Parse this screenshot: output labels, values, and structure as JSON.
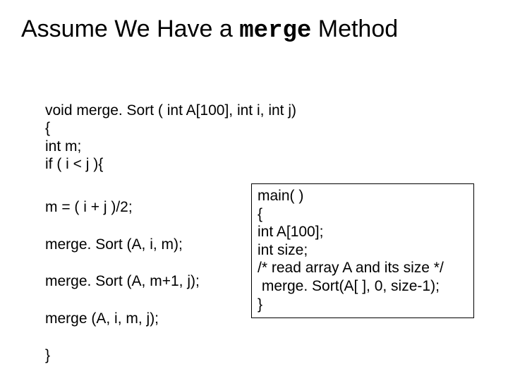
{
  "title_pre": "Assume We Have a ",
  "title_mono": "merge",
  "title_post": " Method",
  "left": {
    "l1": "void merge. Sort ( int A[100], int i, int j)",
    "l2": "{",
    "l3": "int m;",
    "l4": "if ( i < j ){",
    "b1": "m = ( i + j )/2;",
    "b2": "merge. Sort (A, i, m);",
    "b3": "merge. Sort (A, m+1, j);",
    "b4": "merge (A, i, m, j);\n}"
  },
  "main": {
    "l1": "main( )",
    "l2": "{",
    "l3": "int A[100];",
    "l4": "int size;",
    "l5": "/* read array A and its size */",
    "l6": " merge. Sort(A[ ], 0, size-1);",
    "l7": "}"
  }
}
